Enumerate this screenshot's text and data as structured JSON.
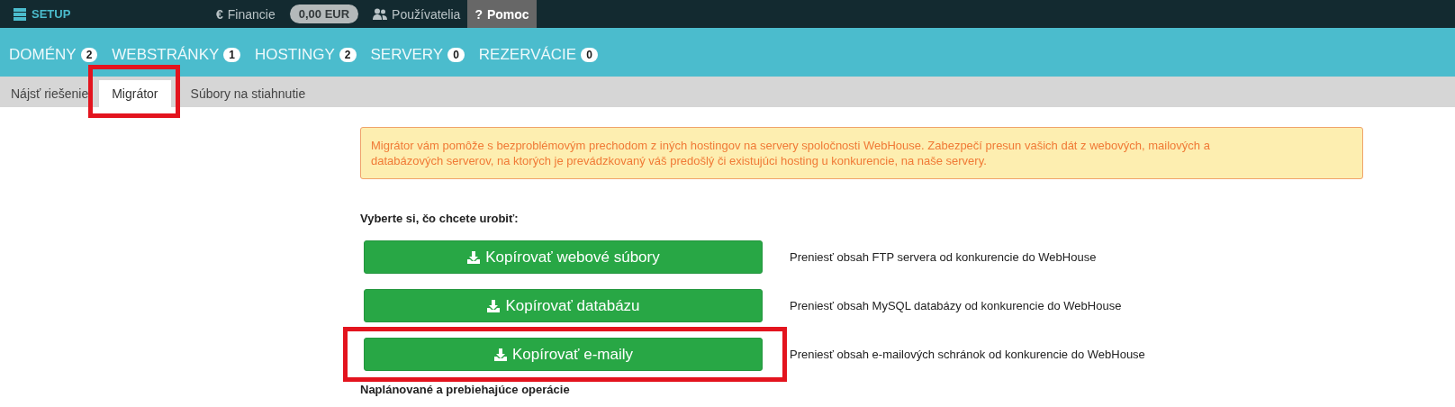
{
  "top_bar": {
    "logo": "SETUP",
    "links": [
      {
        "kind": "glyph",
        "icon_text": "€",
        "label": "Financie",
        "selected": false
      },
      {
        "kind": "balance",
        "label": "0,00 EUR",
        "selected": false
      },
      {
        "kind": "users",
        "label": "Používatelia",
        "selected": false
      },
      {
        "kind": "glyph",
        "icon_text": "?",
        "label": "Pomoc",
        "selected": true
      }
    ]
  },
  "main_tabs": [
    {
      "label": "DOMÉNY",
      "count": "2",
      "selected": false
    },
    {
      "label": "WEBSTRÁNKY",
      "count": "1",
      "selected": false
    },
    {
      "label": "HOSTINGY",
      "count": "2",
      "selected": false
    },
    {
      "label": "SERVERY",
      "count": "0",
      "selected": false
    },
    {
      "label": "REZERVÁCIE",
      "count": "0",
      "selected": false
    }
  ],
  "sub_tabs": [
    {
      "label": "Nájsť riešenie",
      "selected": false,
      "highlighted": false
    },
    {
      "label": "Migrátor",
      "selected": true,
      "highlighted": true
    },
    {
      "label": "Súbory na stiahnutie",
      "selected": false,
      "highlighted": false
    }
  ],
  "notice": "Migrátor vám pomôže s bezproblémovým prechodom z iných hostingov na servery spoločnosti WebHouse. Zabezpečí presun vašich dát z webových, mailových a databázových serverov, na ktorých je prevádzkovaný váš predošlý či existujúci hosting u konkurencie, na naše servery.",
  "prompt": "Vyberte si, čo chcete urobiť:",
  "actions": [
    {
      "label": "Kopírovať webové súbory",
      "description": "Preniesť obsah FTP servera od konkurencie do WebHouse",
      "highlighted": false
    },
    {
      "label": "Kopírovať databázu",
      "description": "Preniesť obsah MySQL databázy od konkurencie do WebHouse",
      "highlighted": false
    },
    {
      "label": "Kopírovať e-maily",
      "description": "Preniesť obsah e-mailových schránok od konkurencie do WebHouse",
      "highlighted": true
    }
  ],
  "section_heading": "Naplánované a prebiehajúce operácie"
}
